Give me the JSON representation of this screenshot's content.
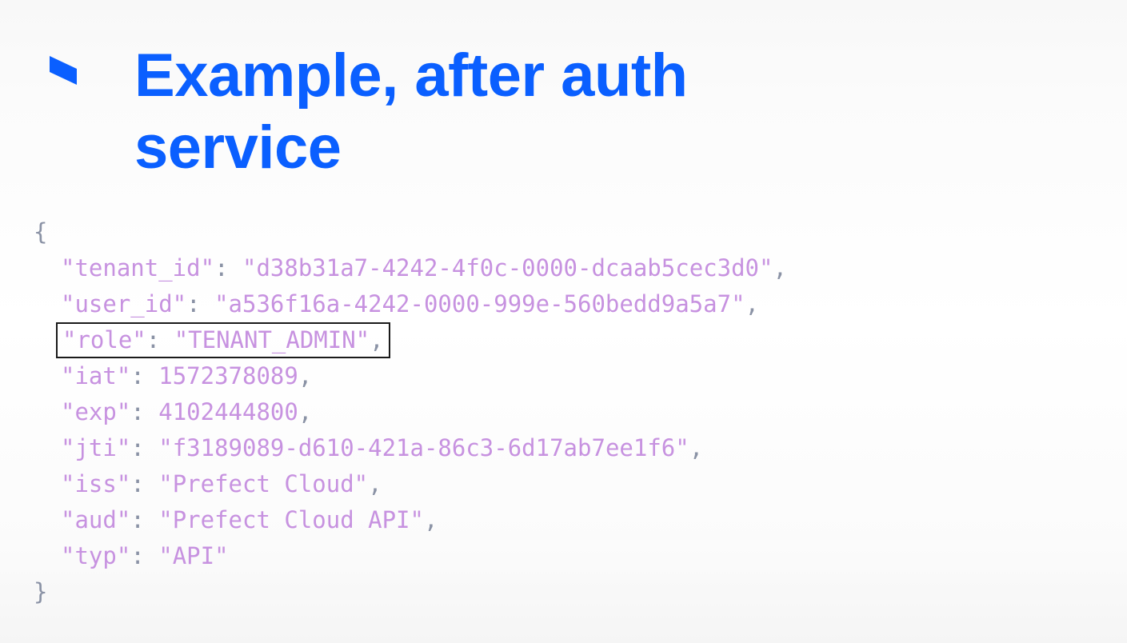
{
  "title": "Example, after auth service",
  "code": {
    "open_brace": "{",
    "close_brace": "}",
    "lines": [
      {
        "key": "\"tenant_id\"",
        "sep": ": ",
        "value": "\"d38b31a7-4242-4f0c-0000-dcaab5cec3d0\"",
        "comma": ",",
        "highlight": false,
        "type": "string"
      },
      {
        "key": "\"user_id\"",
        "sep": ": ",
        "value": "\"a536f16a-4242-0000-999e-560bedd9a5a7\"",
        "comma": ",",
        "highlight": false,
        "type": "string"
      },
      {
        "key": "\"role\"",
        "sep": ": ",
        "value": "\"TENANT_ADMIN\"",
        "comma": ",",
        "highlight": true,
        "type": "string"
      },
      {
        "key": "\"iat\"",
        "sep": ": ",
        "value": "1572378089",
        "comma": ",",
        "highlight": false,
        "type": "number"
      },
      {
        "key": "\"exp\"",
        "sep": ": ",
        "value": "4102444800",
        "comma": ",",
        "highlight": false,
        "type": "number"
      },
      {
        "key": "\"jti\"",
        "sep": ": ",
        "value": "\"f3189089-d610-421a-86c3-6d17ab7ee1f6\"",
        "comma": ",",
        "highlight": false,
        "type": "string"
      },
      {
        "key": "\"iss\"",
        "sep": ": ",
        "value": "\"Prefect Cloud\"",
        "comma": ",",
        "highlight": false,
        "type": "string"
      },
      {
        "key": "\"aud\"",
        "sep": ": ",
        "value": "\"Prefect Cloud API\"",
        "comma": ",",
        "highlight": false,
        "type": "string"
      },
      {
        "key": "\"typ\"",
        "sep": ": ",
        "value": "\"API\"",
        "comma": "",
        "highlight": false,
        "type": "string"
      }
    ]
  }
}
